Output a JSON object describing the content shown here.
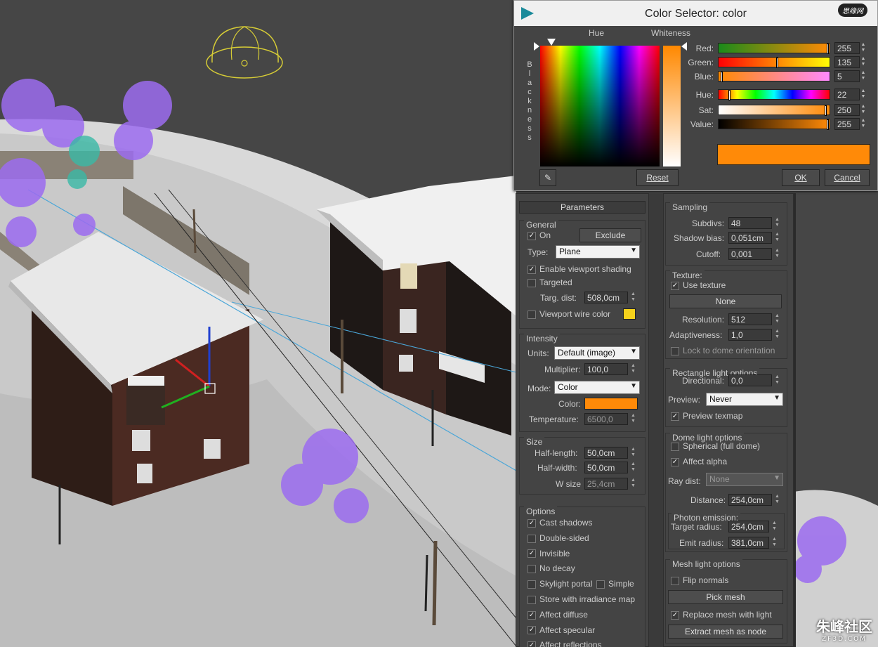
{
  "dialog": {
    "title": "Color Selector: color",
    "logo_text": "思缘网",
    "hue_label": "Hue",
    "whiteness_label": "Whiteness",
    "blackness_label": "Blackness",
    "sliders": [
      {
        "label": "Red:",
        "value": "255",
        "thumb": 1.0
      },
      {
        "label": "Green:",
        "value": "135",
        "thumb": 0.53
      },
      {
        "label": "Blue:",
        "value": "5",
        "thumb": 0.02
      },
      {
        "label": "Hue:",
        "value": "22",
        "thumb": 0.09
      },
      {
        "label": "Sat:",
        "value": "250",
        "thumb": 0.98
      },
      {
        "label": "Value:",
        "value": "255",
        "thumb": 1.0
      }
    ],
    "reset_label": "Reset",
    "ok_label": "OK",
    "cancel_label": "Cancel",
    "current_color": "#ff8a08"
  },
  "left_panel": {
    "header": "Parameters",
    "general": {
      "title": "General",
      "on_label": "On",
      "on_checked": true,
      "exclude_label": "Exclude",
      "type_label": "Type:",
      "type_value": "Plane",
      "enable_viewport_label": "Enable viewport shading",
      "enable_viewport_checked": true,
      "targeted_label": "Targeted",
      "targeted_checked": false,
      "targ_dist_label": "Targ. dist:",
      "targ_dist_value": "508,0cm",
      "viewport_wire_label": "Viewport wire color",
      "viewport_wire_checked": false,
      "wire_color": "#f5d21c"
    },
    "intensity": {
      "title": "Intensity",
      "units_label": "Units:",
      "units_value": "Default (image)",
      "multiplier_label": "Multiplier:",
      "multiplier_value": "100,0",
      "mode_label": "Mode:",
      "mode_value": "Color",
      "color_label": "Color:",
      "color_swatch": "#ff8a08",
      "temperature_label": "Temperature:",
      "temperature_value": "6500,0"
    },
    "size": {
      "title": "Size",
      "half_length_label": "Half-length:",
      "half_length_value": "50,0cm",
      "half_width_label": "Half-width:",
      "half_width_value": "50,0cm",
      "w_size_label": "W size",
      "w_size_value": "25,4cm"
    },
    "options": {
      "title": "Options",
      "items": [
        {
          "label": "Cast shadows",
          "checked": true
        },
        {
          "label": "Double-sided",
          "checked": false
        },
        {
          "label": "Invisible",
          "checked": true
        },
        {
          "label": "No decay",
          "checked": false
        },
        {
          "label": "Skylight portal",
          "checked": false
        },
        {
          "label": "Store with irradiance map",
          "checked": false
        },
        {
          "label": "Affect diffuse",
          "checked": true
        },
        {
          "label": "Affect specular",
          "checked": true
        },
        {
          "label": "Affect reflections",
          "checked": true
        }
      ],
      "simple_label": "Simple",
      "simple_checked": false
    }
  },
  "right_panel": {
    "sampling": {
      "title": "Sampling",
      "subdivs_label": "Subdivs:",
      "subdivs_value": "48",
      "shadow_bias_label": "Shadow bias:",
      "shadow_bias_value": "0,051cm",
      "cutoff_label": "Cutoff:",
      "cutoff_value": "0,001"
    },
    "texture": {
      "title": "Texture:",
      "use_texture_label": "Use texture",
      "use_texture_checked": true,
      "none_label": "None",
      "resolution_label": "Resolution:",
      "resolution_value": "512",
      "adaptiveness_label": "Adaptiveness:",
      "adaptiveness_value": "1,0",
      "lock_label": "Lock to dome orientation",
      "lock_checked": false
    },
    "rect": {
      "title": "Rectangle light options",
      "directional_label": "Directional:",
      "directional_value": "0,0",
      "preview_label": "Preview:",
      "preview_value": "Never",
      "preview_texmap_label": "Preview texmap",
      "preview_texmap_checked": true
    },
    "dome": {
      "title": "Dome light options",
      "spherical_label": "Spherical (full dome)",
      "spherical_checked": false,
      "affect_alpha_label": "Affect alpha",
      "affect_alpha_checked": true,
      "ray_dist_label": "Ray dist:",
      "ray_dist_value": "None",
      "distance_label": "Distance:",
      "distance_value": "254,0cm",
      "photon_title": "Photon emission:",
      "target_radius_label": "Target radius:",
      "target_radius_value": "254,0cm",
      "emit_radius_label": "Emit radius:",
      "emit_radius_value": "381,0cm"
    },
    "mesh": {
      "title": "Mesh light options",
      "flip_label": "Flip normals",
      "flip_checked": false,
      "pick_mesh_label": "Pick mesh",
      "replace_label": "Replace mesh with light",
      "replace_checked": true,
      "extract_label": "Extract mesh as node"
    }
  },
  "watermark": {
    "text": "朱峰社区",
    "sub": "ZF3D.COM"
  }
}
